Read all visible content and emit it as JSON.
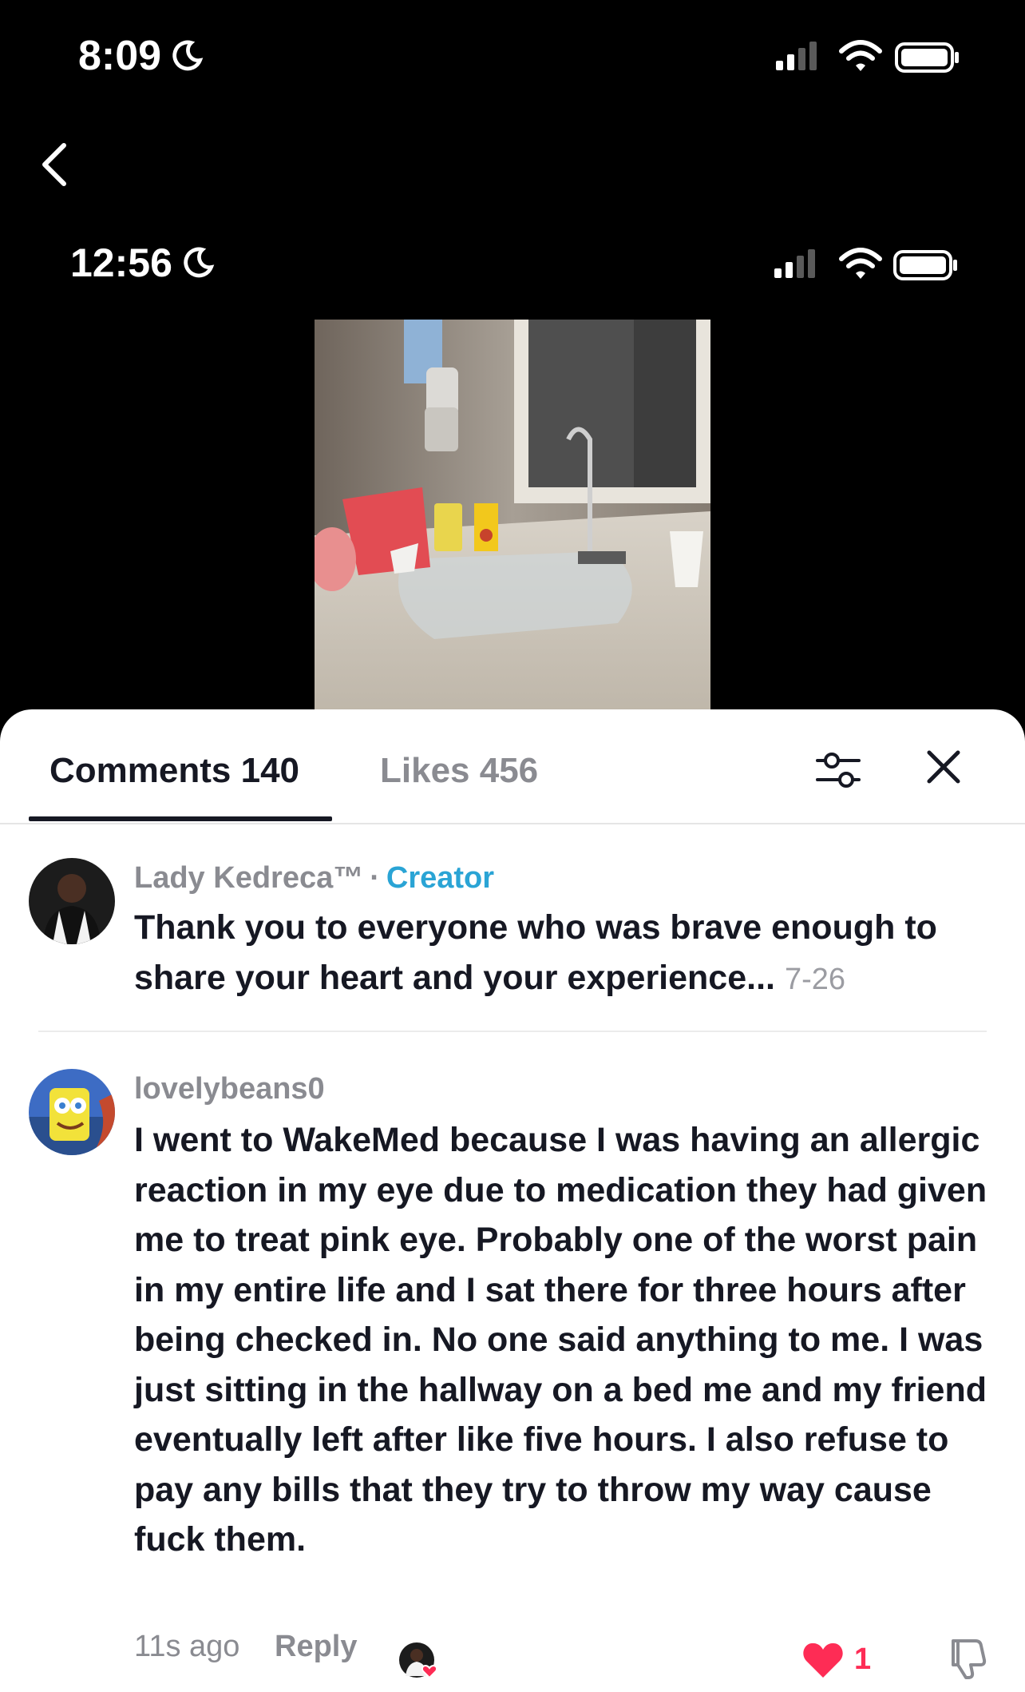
{
  "outer_status": {
    "time": "8:09"
  },
  "inner_status": {
    "time": "12:56"
  },
  "tabs": [
    {
      "label": "Comments 140",
      "active": true
    },
    {
      "label": "Likes 456",
      "active": false
    }
  ],
  "comments": [
    {
      "username": "Lady Kedreca™",
      "separator": "·",
      "badge": "Creator",
      "text": "Thank you to everyone who was brave enough to share your heart and your experience...",
      "date": "7-26"
    },
    {
      "username": "lovelybeans0",
      "text": "I went to WakeMed because I was having an allergic reaction in my eye due to medication they had given me to treat pink eye. Probably one of the worst pain in my entire life and I sat there for three hours after being checked in. No one said anything to me. I was just sitting in the hallway on a bed me and my friend eventually left after like five hours. I also refuse to pay any bills that they try to throw my way cause fuck them.",
      "time_ago": "11s ago",
      "reply_label": "Reply",
      "like_count": "1",
      "liked": true
    }
  ],
  "colors": {
    "accent_blue": "#2aa4d5",
    "like_red": "#fe2c55",
    "text_primary": "#161823",
    "text_secondary": "#8a8b91"
  },
  "icons": [
    "moon-icon",
    "cellular-signal-icon",
    "wifi-icon",
    "battery-icon",
    "back-chevron-icon",
    "filter-sliders-icon",
    "close-icon",
    "heart-icon",
    "dislike-icon"
  ]
}
